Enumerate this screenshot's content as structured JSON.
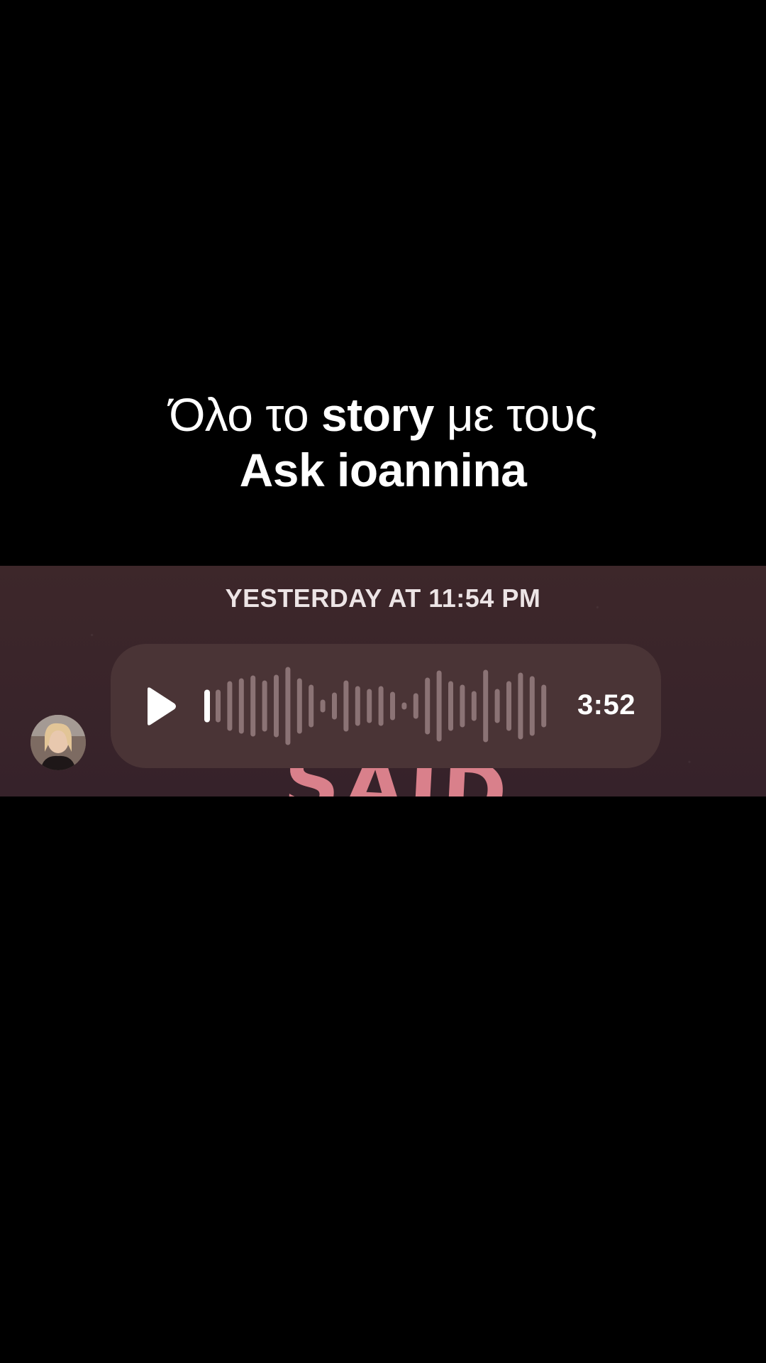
{
  "caption": {
    "line1_part1": "Όλο το ",
    "line1_bold": "story",
    "line1_part2": " με τους",
    "line2": "Ask ioannina"
  },
  "message": {
    "timestamp": "YESTERDAY AT 11:54 PM",
    "voice_note": {
      "play_icon": "play-icon",
      "duration": "3:52",
      "progress": 0
    },
    "background_text": "SAID"
  },
  "colors": {
    "background": "#000000",
    "chat_background": "#3a2528",
    "bubble": "#4a3436",
    "waveform_bar": "#8b7375",
    "accent_text": "#d9808b"
  }
}
